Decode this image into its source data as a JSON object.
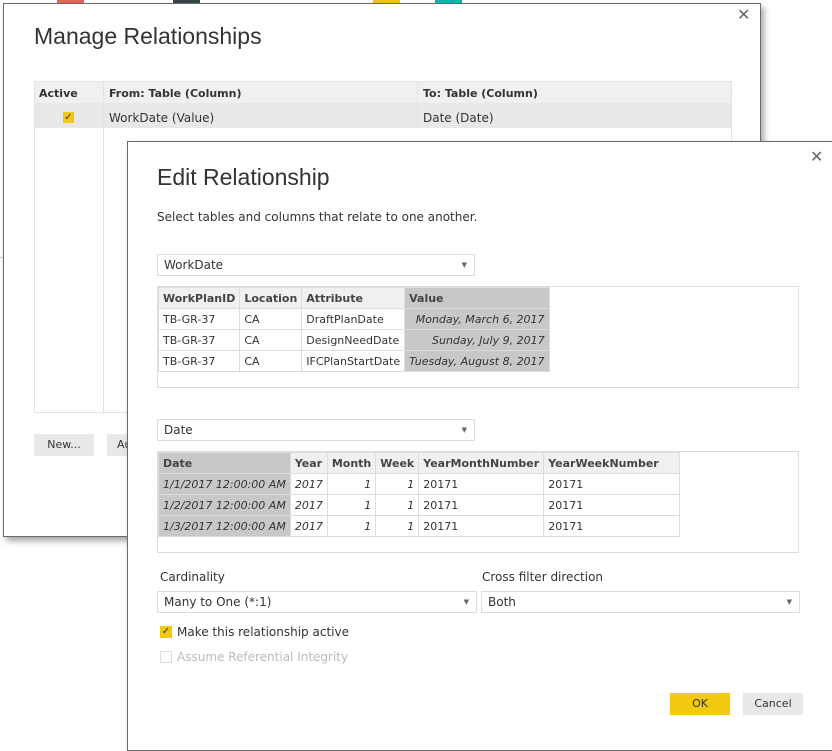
{
  "accent_colors": {
    "red": "#e8645a",
    "dark": "#374649",
    "yellow": "#f2c811",
    "teal": "#01b8aa"
  },
  "manage": {
    "title": "Manage Relationships",
    "close_icon": "close-icon",
    "columns": [
      "Active",
      "From: Table (Column)",
      "To: Table (Column)"
    ],
    "rows": [
      {
        "active": true,
        "from": "WorkDate (Value)",
        "to": "Date (Date)"
      }
    ],
    "buttons": {
      "new": "New...",
      "auto": "Autodetect..."
    }
  },
  "edit": {
    "title": "Edit Relationship",
    "subtitle": "Select tables and columns that relate to one another.",
    "table1": {
      "selected": "WorkDate",
      "columns": [
        "WorkPlanID",
        "Location",
        "Attribute",
        "Value"
      ],
      "selected_column": "Value",
      "rows": [
        [
          "TB-GR-37",
          "CA",
          "DraftPlanDate",
          "Monday, March 6, 2017"
        ],
        [
          "TB-GR-37",
          "CA",
          "DesignNeedDate",
          "Sunday, July 9, 2017"
        ],
        [
          "TB-GR-37",
          "CA",
          "IFCPlanStartDate",
          "Tuesday, August 8, 2017"
        ]
      ]
    },
    "table2": {
      "selected": "Date",
      "columns": [
        "Date",
        "Year",
        "Month",
        "Week",
        "YearMonthNumber",
        "YearWeekNumber"
      ],
      "selected_column": "Date",
      "rows": [
        [
          "1/1/2017 12:00:00 AM",
          "2017",
          "1",
          "1",
          "20171",
          "20171"
        ],
        [
          "1/2/2017 12:00:00 AM",
          "2017",
          "1",
          "1",
          "20171",
          "20171"
        ],
        [
          "1/3/2017 12:00:00 AM",
          "2017",
          "1",
          "1",
          "20171",
          "20171"
        ]
      ]
    },
    "cardinality": {
      "label": "Cardinality",
      "value": "Many to One (*:1)"
    },
    "cross_filter": {
      "label": "Cross filter direction",
      "value": "Both"
    },
    "make_active": {
      "label": "Make this relationship active",
      "checked": true
    },
    "referential": {
      "label": "Assume Referential Integrity",
      "checked": false,
      "disabled": true
    },
    "ok": "OK",
    "cancel": "Cancel"
  }
}
